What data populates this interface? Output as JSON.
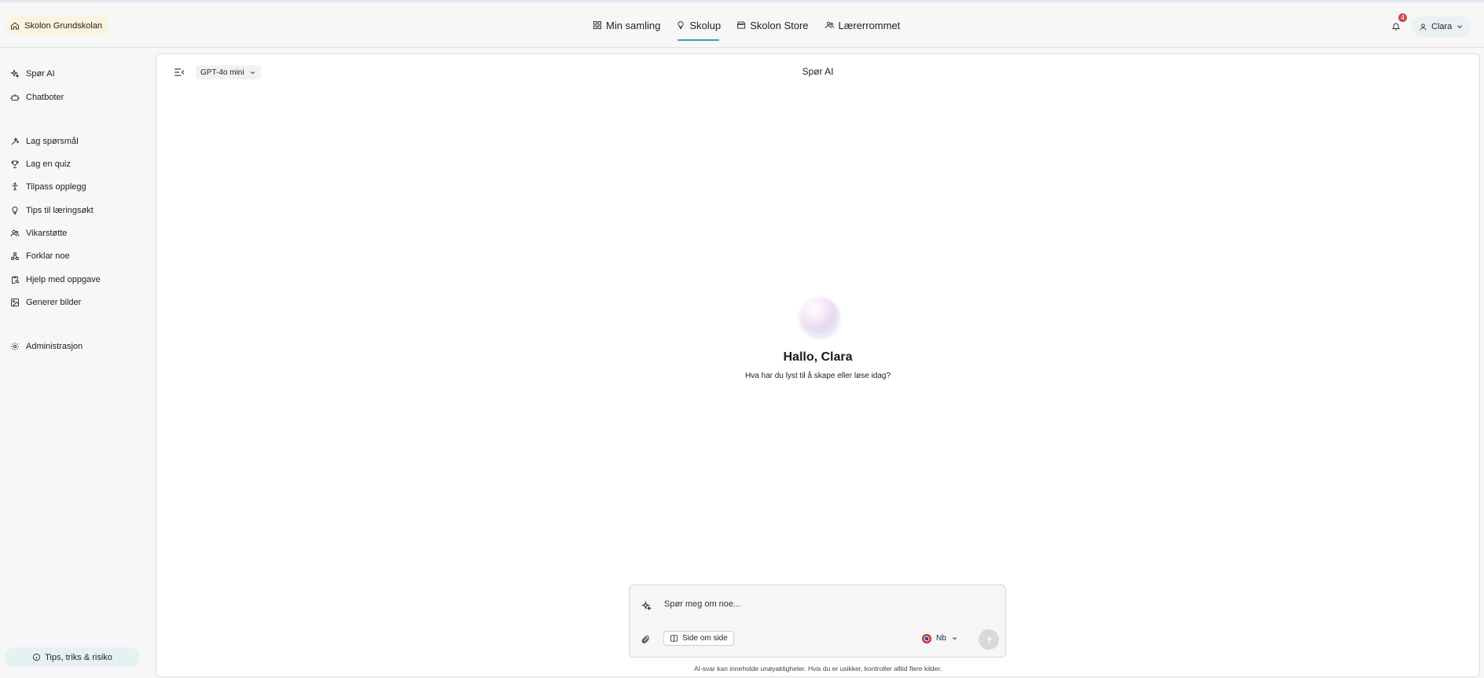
{
  "header": {
    "school": "Skolon Grundskolan",
    "nav": [
      {
        "label": "Min samling",
        "icon": "grid-icon"
      },
      {
        "label": "Skolup",
        "icon": "lightbulb-icon",
        "active": true
      },
      {
        "label": "Skolon Store",
        "icon": "store-icon"
      },
      {
        "label": "Lærerrommet",
        "icon": "people-icon"
      }
    ],
    "notification_count": "4",
    "user_name": "Clara"
  },
  "sidebar": {
    "items": [
      {
        "label": "Spør AI",
        "icon": "sparkles-icon"
      },
      {
        "label": "Chatboter",
        "icon": "bot-icon"
      },
      {
        "label": "Lag spørsmål",
        "icon": "wand-icon"
      },
      {
        "label": "Lag en quiz",
        "icon": "trophy-icon"
      },
      {
        "label": "Tilpass opplegg",
        "icon": "accessibility-icon"
      },
      {
        "label": "Tips til læringsøkt",
        "icon": "lightbulb-icon"
      },
      {
        "label": "Vikarstøtte",
        "icon": "users-icon"
      },
      {
        "label": "Forklar noe",
        "icon": "shapes-icon"
      },
      {
        "label": "Hjelp med oppgave",
        "icon": "clipboard-search-icon"
      },
      {
        "label": "Generer bilder",
        "icon": "image-icon"
      },
      {
        "label": "Administrasjon",
        "icon": "gear-icon"
      }
    ],
    "tips_label": "Tips, triks & risiko"
  },
  "main": {
    "model": "GPT-4o mini",
    "title": "Spør AI",
    "greeting": "Hallo, Clara",
    "subtitle": "Hva har du lyst til å skape eller løse idag?",
    "composer": {
      "placeholder": "Spør meg om noe...",
      "side_by_side": "Side om side",
      "language": "Nb"
    },
    "disclaimer": "AI-svar kan inneholde unøyaktigheter. Hvis du er usikker, kontroller alltid flere kilder."
  },
  "colors": {
    "accent": "#3aa0ad",
    "badge": "#d04b4b",
    "school_pill": "#fbf3dc",
    "user_pill": "#e9f1f3"
  }
}
